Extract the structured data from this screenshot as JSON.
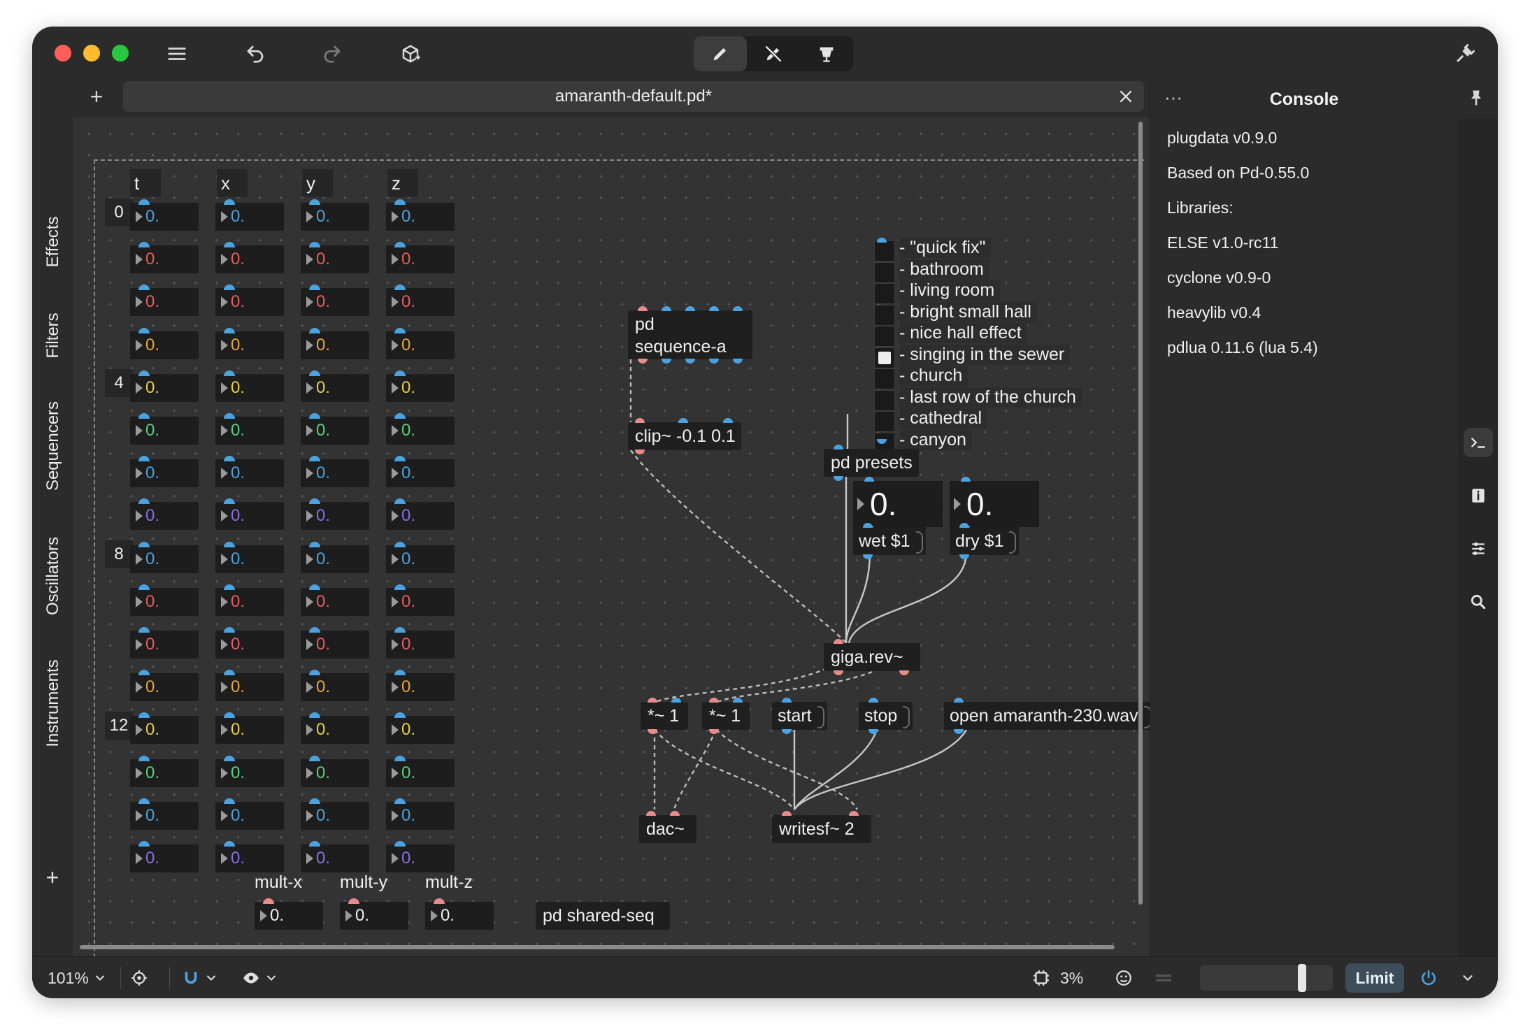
{
  "window": {
    "tab_title": "amaranth-default.pd*",
    "mode_buttons": [
      "edit-mode",
      "run-mode",
      "presentation-mode"
    ]
  },
  "left_sidebar": {
    "categories": [
      "Effects",
      "Filters",
      "Sequencers",
      "Oscillators",
      "Instruments"
    ],
    "add_label": "+"
  },
  "console": {
    "title": "Console",
    "more_label": "···",
    "lines": [
      "plugdata v0.9.0",
      "Based on Pd-0.55.0",
      "Libraries:",
      "ELSE v1.0-rc11",
      "cyclone v0.9-0",
      "heavylib v0.4",
      "pdlua 0.11.6 (lua 5.4)"
    ]
  },
  "patch": {
    "columns": [
      "t",
      "x",
      "y",
      "z"
    ],
    "row_labels": [
      "0",
      "4",
      "8",
      "12"
    ],
    "number_value": "0.",
    "row_colors": [
      "#4aa3e0",
      "#e85c5c",
      "#e85c5c",
      "#e8a640",
      "#e8d040",
      "#5ccf7a",
      "#4aa3e0",
      "#8b6be8",
      "#4aa3e0",
      "#e85c5c",
      "#e85c5c",
      "#e8a640",
      "#e8d040",
      "#5ccf7a",
      "#4aa3e0",
      "#8b6be8"
    ],
    "mult_labels": [
      "mult-x",
      "mult-y",
      "mult-z"
    ],
    "objects": {
      "pd_sequence_line1": "pd",
      "pd_sequence_line2": "sequence-a",
      "clip": "clip~ -0.1 0.1",
      "pd_presets": "pd presets",
      "giga_rev": "giga.rev~",
      "mul1": "*~ 1",
      "mul2": "*~ 1",
      "dac": "dac~",
      "writesf": "writesf~ 2",
      "pd_shared_seq": "pd shared-seq"
    },
    "messages": {
      "wet": "wet $1",
      "dry": "dry $1",
      "start": "start",
      "stop": "stop",
      "open": "open amaranth-230.wav"
    },
    "big_numbers": [
      "0.",
      "0."
    ],
    "presets": [
      "- \"quick fix\"",
      "- bathroom",
      "- living room",
      "- bright small hall",
      "- nice hall effect",
      "- singing in the sewer",
      "- church",
      "- last row of the church",
      "- cathedral",
      "- canyon"
    ],
    "selected_preset": 5
  },
  "statusbar": {
    "zoom": "101%",
    "cpu": "3%",
    "limit_label": "Limit",
    "volume_level": 0.75
  }
}
